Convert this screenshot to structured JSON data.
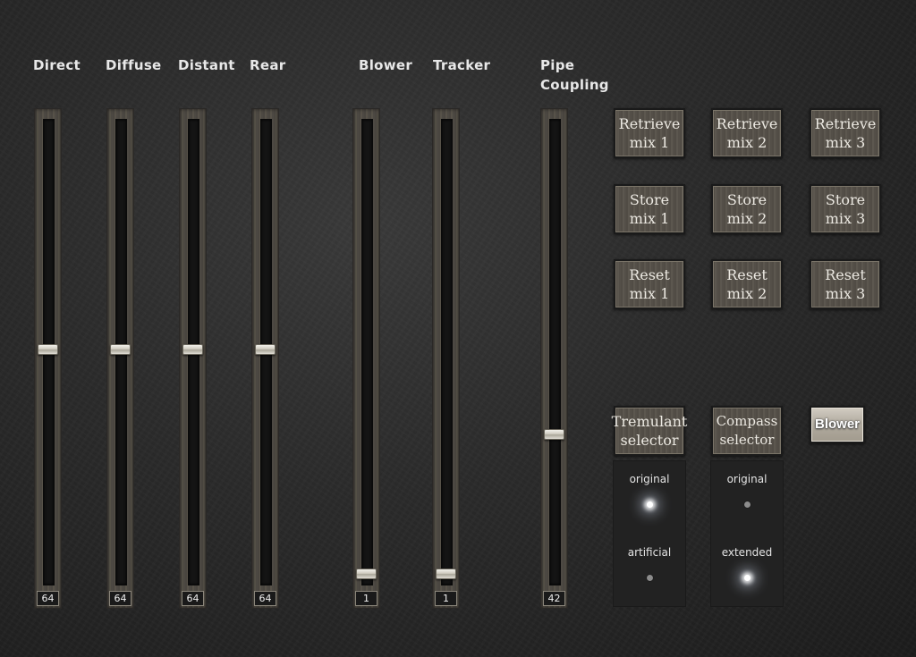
{
  "sliders": [
    {
      "label": "Direct",
      "value": "64",
      "fraction": 0.5
    },
    {
      "label": "Diffuse",
      "value": "64",
      "fraction": 0.5
    },
    {
      "label": "Distant",
      "value": "64",
      "fraction": 0.5
    },
    {
      "label": "Rear",
      "value": "64",
      "fraction": 0.5
    },
    {
      "label": "Blower",
      "value": "1",
      "fraction": 0.0
    },
    {
      "label": "Tracker",
      "value": "1",
      "fraction": 0.0
    },
    {
      "label": "Pipe Coupling",
      "label_lines": [
        "Pipe",
        "Coupling"
      ],
      "value": "42",
      "fraction": 0.31
    }
  ],
  "mix_buttons": {
    "retrieve": [
      {
        "line1": "Retrieve",
        "line2": "mix 1"
      },
      {
        "line1": "Retrieve",
        "line2": "mix 2"
      },
      {
        "line1": "Retrieve",
        "line2": "mix 3"
      }
    ],
    "store": [
      {
        "line1": "Store",
        "line2": "mix 1"
      },
      {
        "line1": "Store",
        "line2": "mix 2"
      },
      {
        "line1": "Store",
        "line2": "mix 3"
      }
    ],
    "reset": [
      {
        "line1": "Reset",
        "line2": "mix 1"
      },
      {
        "line1": "Reset",
        "line2": "mix 2"
      },
      {
        "line1": "Reset",
        "line2": "mix 3"
      }
    ]
  },
  "tremulant": {
    "line1": "Tremulant",
    "line2": "selector",
    "options": [
      {
        "label": "original",
        "active": true
      },
      {
        "label": "artificial",
        "active": false
      }
    ]
  },
  "compass": {
    "line1": "Compass",
    "line2": "selector",
    "options": [
      {
        "label": "original",
        "active": false
      },
      {
        "label": "extended",
        "active": true
      }
    ]
  },
  "blower_button": {
    "label": "Blower",
    "active": true
  },
  "colors": {
    "background": "#2b2b2b",
    "fader_wood": "#514c45",
    "knob": "#e0ddd5",
    "led_on": "#ffffff",
    "led_off": "#8c8c8c"
  }
}
